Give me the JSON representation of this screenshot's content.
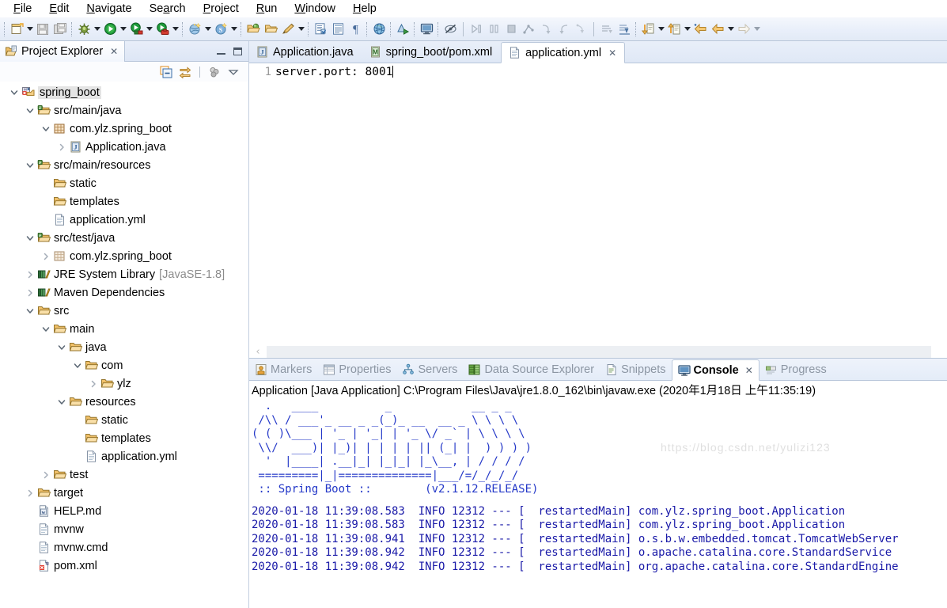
{
  "menu": {
    "items": [
      {
        "label": "File",
        "mnemonic": "F"
      },
      {
        "label": "Edit",
        "mnemonic": "E"
      },
      {
        "label": "Navigate",
        "mnemonic": "N"
      },
      {
        "label": "Search",
        "mnemonic": "a"
      },
      {
        "label": "Project",
        "mnemonic": "P"
      },
      {
        "label": "Run",
        "mnemonic": "R"
      },
      {
        "label": "Window",
        "mnemonic": "W"
      },
      {
        "label": "Help",
        "mnemonic": "H"
      }
    ]
  },
  "toolbar": {
    "icons": [
      "new-wizard-icon",
      "save-icon",
      "save-all-icon",
      "debug-icon",
      "run-icon",
      "run-external-tools-icon",
      "coverage-icon",
      "new-spring-starter-icon",
      "spring-boot-dashboard-icon",
      "open-type-icon",
      "open-resource-icon",
      "pencil-annotation-icon",
      "new-java-class-icon",
      "new-java-package-icon",
      "pilcrow-icon",
      "open-web-browser-icon",
      "run-last-tool-icon",
      "terminal-icon",
      "toggle-breadcrumb-icon",
      "step-over-icon",
      "step-pause-icon",
      "stop-icon",
      "relaunch-icon",
      "step-return-icon",
      "step-into-icon",
      "step-filter-icon",
      "next-annotation-icon",
      "previous-annotation-icon",
      "last-edit-location-icon",
      "back-icon",
      "forward-icon"
    ]
  },
  "explorer": {
    "title": "Project Explorer",
    "close_label": "✕",
    "view_icons": [
      "collapse-all-icon",
      "link-with-editor-icon",
      "view-filter-icon",
      "view-menu-icon"
    ],
    "tree": [
      {
        "depth": 0,
        "label": "spring_boot",
        "icon": "maven-project-icon",
        "twisty": "open",
        "selected": true
      },
      {
        "depth": 1,
        "label": "src/main/java",
        "icon": "source-folder-icon",
        "twisty": "open"
      },
      {
        "depth": 2,
        "label": "com.ylz.spring_boot",
        "icon": "package-icon",
        "twisty": "open"
      },
      {
        "depth": 3,
        "label": "Application.java",
        "icon": "java-file-icon",
        "twisty": "closed"
      },
      {
        "depth": 1,
        "label": "src/main/resources",
        "icon": "source-folder-icon",
        "twisty": "open"
      },
      {
        "depth": 2,
        "label": "static",
        "icon": "folder-icon",
        "twisty": "none"
      },
      {
        "depth": 2,
        "label": "templates",
        "icon": "folder-icon",
        "twisty": "none"
      },
      {
        "depth": 2,
        "label": "application.yml",
        "icon": "file-icon",
        "twisty": "none"
      },
      {
        "depth": 1,
        "label": "src/test/java",
        "icon": "source-folder-icon",
        "twisty": "open"
      },
      {
        "depth": 2,
        "label": "com.ylz.spring_boot",
        "icon": "package-empty-icon",
        "twisty": "closed"
      },
      {
        "depth": 1,
        "label": "JRE System Library",
        "sublabel": "[JavaSE-1.8]",
        "icon": "library-icon",
        "twisty": "closed"
      },
      {
        "depth": 1,
        "label": "Maven Dependencies",
        "icon": "library-icon",
        "twisty": "closed"
      },
      {
        "depth": 1,
        "label": "src",
        "icon": "folder-icon",
        "twisty": "open"
      },
      {
        "depth": 2,
        "label": "main",
        "icon": "folder-icon",
        "twisty": "open"
      },
      {
        "depth": 3,
        "label": "java",
        "icon": "folder-icon",
        "twisty": "open"
      },
      {
        "depth": 4,
        "label": "com",
        "icon": "folder-icon",
        "twisty": "open"
      },
      {
        "depth": 5,
        "label": "ylz",
        "icon": "folder-icon",
        "twisty": "closed"
      },
      {
        "depth": 3,
        "label": "resources",
        "icon": "folder-icon",
        "twisty": "open"
      },
      {
        "depth": 4,
        "label": "static",
        "icon": "folder-icon",
        "twisty": "none"
      },
      {
        "depth": 4,
        "label": "templates",
        "icon": "folder-icon",
        "twisty": "none"
      },
      {
        "depth": 4,
        "label": "application.yml",
        "icon": "file-icon",
        "twisty": "none"
      },
      {
        "depth": 2,
        "label": "test",
        "icon": "folder-icon",
        "twisty": "closed"
      },
      {
        "depth": 1,
        "label": "target",
        "icon": "folder-icon",
        "twisty": "closed"
      },
      {
        "depth": 1,
        "label": "HELP.md",
        "icon": "markdown-file-icon",
        "twisty": "none"
      },
      {
        "depth": 1,
        "label": "mvnw",
        "icon": "file-icon",
        "twisty": "none"
      },
      {
        "depth": 1,
        "label": "mvnw.cmd",
        "icon": "file-icon",
        "twisty": "none"
      },
      {
        "depth": 1,
        "label": "pom.xml",
        "icon": "pom-file-icon",
        "twisty": "none"
      }
    ]
  },
  "editor": {
    "tabs": [
      {
        "label": "Application.java",
        "icon": "java-file-icon",
        "active": false,
        "closable": false
      },
      {
        "label": "spring_boot/pom.xml",
        "icon": "maven-pom-icon",
        "active": false,
        "closable": false
      },
      {
        "label": "application.yml",
        "icon": "yaml-file-icon",
        "active": true,
        "closable": true
      }
    ],
    "close_label": "✕",
    "lines": [
      {
        "number": "1",
        "text": "server.port: 8001"
      }
    ],
    "hscroll_left_label": "‹"
  },
  "console": {
    "tabs": [
      {
        "label": "Markers",
        "icon": "markers-icon",
        "active": false,
        "closable": false
      },
      {
        "label": "Properties",
        "icon": "properties-icon",
        "active": false,
        "closable": false
      },
      {
        "label": "Servers",
        "icon": "servers-icon",
        "active": false,
        "closable": false
      },
      {
        "label": "Data Source Explorer",
        "icon": "datasource-icon",
        "active": false,
        "closable": false
      },
      {
        "label": "Snippets",
        "icon": "snippets-icon",
        "active": false,
        "closable": false
      },
      {
        "label": "Console",
        "icon": "console-icon",
        "active": true,
        "closable": true
      },
      {
        "label": "Progress",
        "icon": "progress-icon",
        "active": false,
        "closable": false
      }
    ],
    "close_label": "✕",
    "header": "Application [Java Application] C:\\Program Files\\Java\\jre1.8.0_162\\bin\\javaw.exe (2020年1月18日 上午11:35:19)",
    "banner": "  .   ____          _            __ _ _\n /\\\\ / ___'_ __ _ _(_)_ __  __ _ \\ \\ \\ \\\n( ( )\\___ | '_ | '_| | '_ \\/ _` | \\ \\ \\ \\\n \\\\/  ___)| |_)| | | | | || (_| |  ) ) ) )\n  '  |____| .__|_| |_|_| |_\\__, | / / / /\n =========|_|==============|___/=/_/_/_/",
    "banner_footer": " :: Spring Boot ::        (v2.1.12.RELEASE)",
    "log_lines": [
      {
        "time": "2020-01-18 11:39:08.583",
        "level": "INFO",
        "pid": "12312",
        "sep": "---",
        "thread": "[  restartedMain]",
        "logger": "com.ylz.spring_boot.Application"
      },
      {
        "time": "2020-01-18 11:39:08.583",
        "level": "INFO",
        "pid": "12312",
        "sep": "---",
        "thread": "[  restartedMain]",
        "logger": "com.ylz.spring_boot.Application"
      },
      {
        "time": "2020-01-18 11:39:08.941",
        "level": "INFO",
        "pid": "12312",
        "sep": "---",
        "thread": "[  restartedMain]",
        "logger": "o.s.b.w.embedded.tomcat.TomcatWebServer"
      },
      {
        "time": "2020-01-18 11:39:08.942",
        "level": "INFO",
        "pid": "12312",
        "sep": "---",
        "thread": "[  restartedMain]",
        "logger": "o.apache.catalina.core.StandardService"
      },
      {
        "time": "2020-01-18 11:39:08.942",
        "level": "INFO",
        "pid": "12312",
        "sep": "---",
        "thread": "[  restartedMain]",
        "logger": "org.apache.catalina.core.StandardEngine"
      }
    ],
    "watermark": "https://blog.csdn.net/yulizi123"
  }
}
